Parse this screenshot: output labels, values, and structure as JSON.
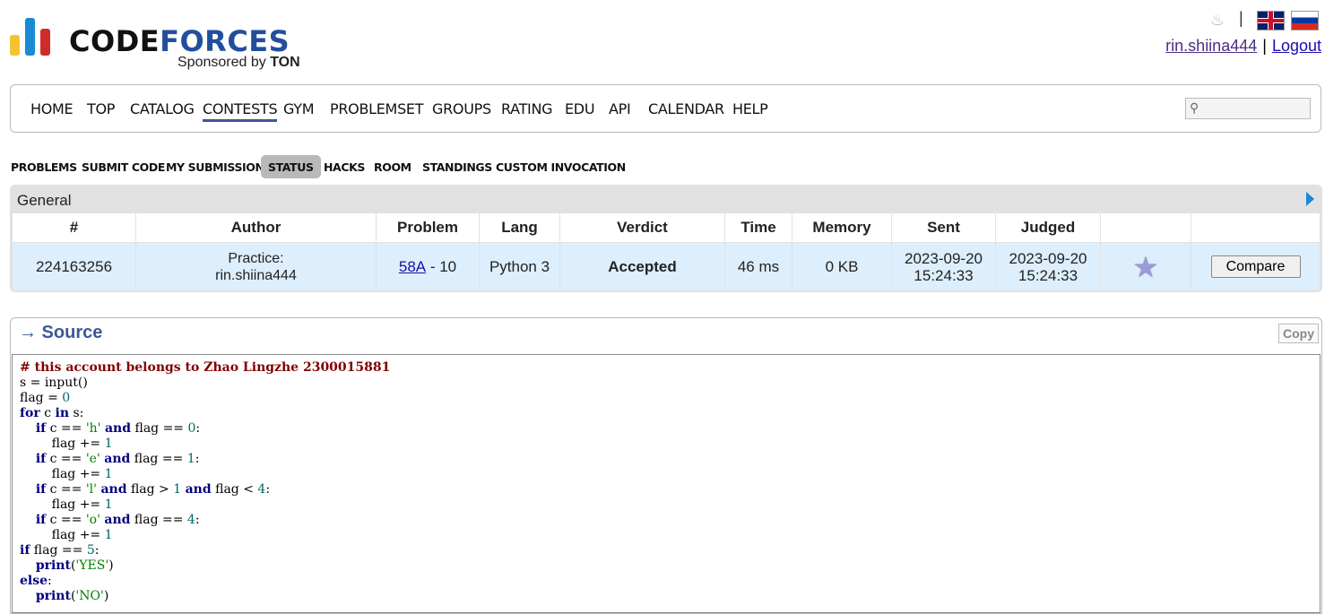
{
  "header": {
    "logo_word_1": "CODE",
    "logo_word_2": "FORCES",
    "sponsor_prefix": "Sponsored by ",
    "sponsor_name": "TON",
    "username": "rin.shiina444",
    "pipe": "|",
    "logout": "Logout",
    "icons": [
      "bell-icon",
      "english-flag-icon",
      "russian-flag-icon"
    ]
  },
  "menu": {
    "items": [
      "HOME",
      "TOP",
      "CATALOG",
      "CONTESTS",
      "GYM",
      "PROBLEMSET",
      "GROUPS",
      "RATING",
      "EDU",
      "API",
      "CALENDAR",
      "HELP"
    ],
    "active": "CONTESTS",
    "search_placeholder": ""
  },
  "second_menu": {
    "items": [
      "PROBLEMS",
      "SUBMIT CODE",
      "MY SUBMISSIONS",
      "STATUS",
      "HACKS",
      "ROOM",
      "STANDINGS",
      "CUSTOM INVOCATION"
    ],
    "active": "STATUS"
  },
  "general": {
    "title": "General",
    "columns": [
      "#",
      "Author",
      "Problem",
      "Lang",
      "Verdict",
      "Time",
      "Memory",
      "Sent",
      "Judged",
      "",
      ""
    ],
    "row": {
      "id": "224163256",
      "author_line1": "Practice:",
      "author_line2": "rin.shiina444",
      "problem_link": "58A",
      "problem_suffix": " - 10",
      "lang": "Python 3",
      "verdict": "Accepted",
      "time": "46 ms",
      "memory": "0 KB",
      "sent_date": "2023-09-20",
      "sent_time": "15:24:33",
      "judged_date": "2023-09-20",
      "judged_time": "15:24:33",
      "compare_label": "Compare"
    }
  },
  "source": {
    "title": "→ Source",
    "copy_label": "Copy",
    "code_lines": [
      "# this account belongs to Zhao Lingzhe 2300015881",
      "s = input()",
      "flag = 0",
      "for c in s:",
      "    if c == 'h' and flag == 0:",
      "        flag += 1",
      "    if c == 'e' and flag == 1:",
      "        flag += 1",
      "    if c == 'l' and flag > 1 and flag < 4:",
      "        flag += 1",
      "    if c == 'o' and flag == 4:",
      "        flag += 1",
      "if flag == 5:",
      "    print('YES')",
      "else:",
      "    print('NO')"
    ]
  },
  "colors": {
    "accent": "#3b5998",
    "accepted": "#00aa00",
    "row_bg": "#ddeefc",
    "panel_bg": "#e1e1e1"
  }
}
